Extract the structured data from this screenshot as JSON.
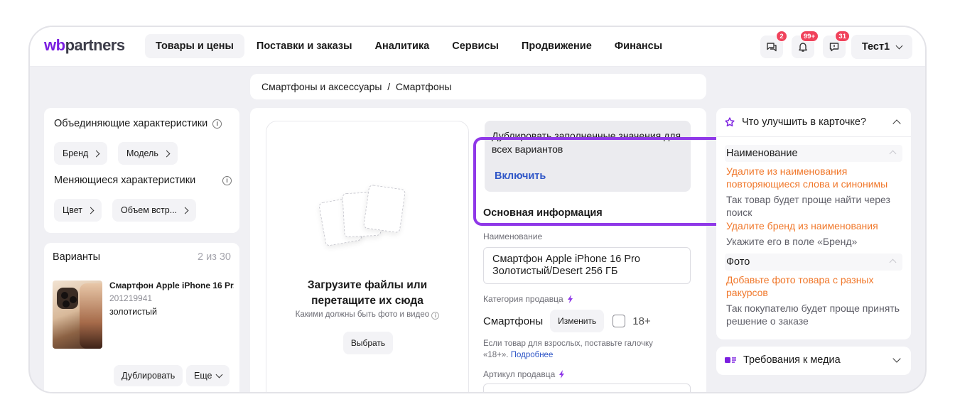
{
  "header": {
    "logo_wb": "wb",
    "logo_rest": "partners",
    "nav": [
      "Товары и цены",
      "Поставки и заказы",
      "Аналитика",
      "Сервисы",
      "Продвижение",
      "Финансы"
    ],
    "badges": {
      "chat": "2",
      "notifications": "99+",
      "support": "31"
    },
    "user_label": "Тест1"
  },
  "breadcrumb": "Смартфоны и аксессуары  /  Смартфоны",
  "characteristics": {
    "merging_title": "Объединяющие характеристики",
    "merging_chips": [
      "Бренд",
      "Модель"
    ],
    "changing_title": "Меняющиеся характеристики",
    "changing_chips": [
      "Цвет",
      "Объем встр..."
    ]
  },
  "variants": {
    "title": "Варианты",
    "count": "2 из 30",
    "item": {
      "name": "Смартфон Apple iPhone 16 Pr...",
      "sku": "201219941",
      "color": "золотистый"
    },
    "duplicate_label": "Дублировать",
    "more_label": "Еще"
  },
  "upload": {
    "title_line1": "Загрузите файлы или",
    "title_line2": "перетащите их сюда",
    "subtitle": "Какими должны быть фото и видео",
    "button": "Выбрать"
  },
  "duplicate_box": {
    "text": "Дублировать заполненные значения для всех вариантов",
    "link": "Включить"
  },
  "main_info": {
    "title": "Основная информация",
    "name_label": "Наименование",
    "name_line1": "Смартфон Apple iPhone 16 Pro",
    "name_line2": "Золотистый/Desert 256 ГБ",
    "category_label": "Категория продавца",
    "category_value": "Смартфоны",
    "change_button": "Изменить",
    "age_label": "18+",
    "hint_text": "Если товар для взрослых, поставьте галочку «18+».",
    "hint_link": "Подробнее",
    "sku_label": "Артикул продавца"
  },
  "improve": {
    "title": "Что улучшить в карточке?",
    "name_section": "Наименование",
    "tip1": "Удалите из наименования повторяющиеся слова и синонимы",
    "tip1_desc": "Так товар будет проще найти через поиск",
    "tip2": "Удалите бренд из наименования",
    "tip2_desc": "Укажите его в поле «Бренд»",
    "photo_section": "Фото",
    "tip3": "Добавьте фото товара с разных ракурсов",
    "tip3_desc": "Так покупателю будет проще принять решение о заказе"
  },
  "media_requirements": {
    "title": "Требования к медиа"
  },
  "colors": {
    "accent_purple": "#8f38e8",
    "link_blue": "#2f56c7",
    "tip_orange": "#f0772a",
    "badge_red": "#f0425b"
  }
}
